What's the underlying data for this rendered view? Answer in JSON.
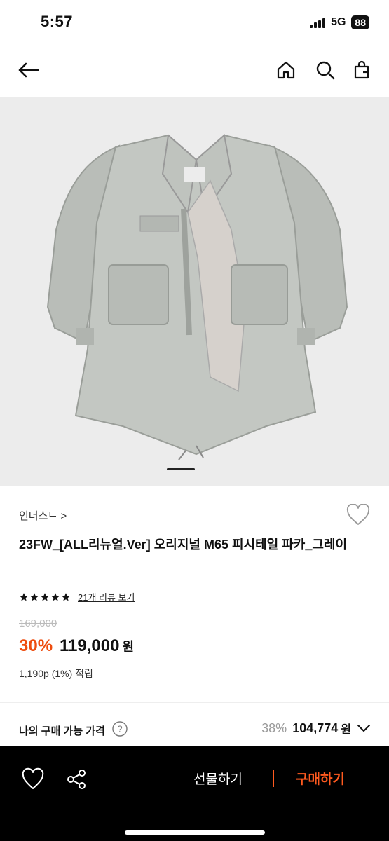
{
  "status_bar": {
    "time": "5:57",
    "network": "5G",
    "battery": "88"
  },
  "header": {
    "back_icon": "arrow-left-icon",
    "home_icon": "home-icon",
    "search_icon": "search-icon",
    "cart_icon": "shopping-bag-icon"
  },
  "product": {
    "brand": "인더스트 >",
    "title": "23FW_[ALL리뉴얼.Ver] 오리지널 M65 피시테일 파카_그레이",
    "rating_stars": 5,
    "review_link": "21개 리뷰 보기",
    "original_price": "169,000",
    "discount": "30%",
    "price": "119,000",
    "currency": "원",
    "points": "1,190p (1%) 적립",
    "image_count_indicator": "1"
  },
  "my_price": {
    "label": "나의 구매 가능 가격",
    "discount": "38%",
    "amount": "104,774",
    "currency": "원"
  },
  "bottom_bar": {
    "gift_label": "선물하기",
    "buy_label": "구매하기",
    "accent": "#ff5a1f"
  },
  "colors": {
    "discount": "#ee4d0f",
    "background_image": "#ececec"
  }
}
